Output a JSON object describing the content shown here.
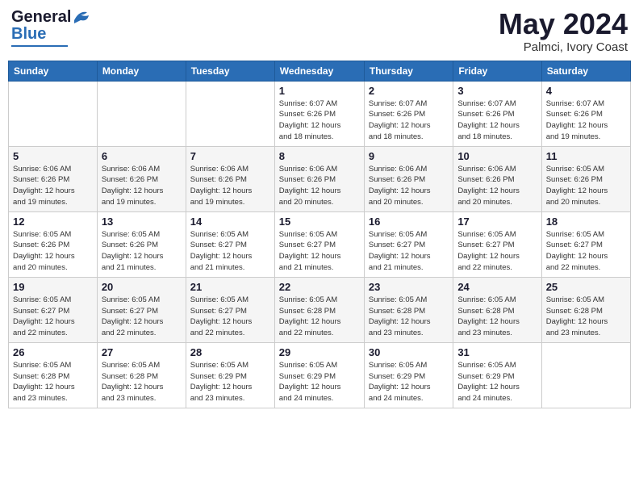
{
  "logo": {
    "general": "General",
    "blue": "Blue"
  },
  "title": "May 2024",
  "location": "Palmci, Ivory Coast",
  "days_header": [
    "Sunday",
    "Monday",
    "Tuesday",
    "Wednesday",
    "Thursday",
    "Friday",
    "Saturday"
  ],
  "weeks": [
    [
      {
        "day": "",
        "info": ""
      },
      {
        "day": "",
        "info": ""
      },
      {
        "day": "",
        "info": ""
      },
      {
        "day": "1",
        "info": "Sunrise: 6:07 AM\nSunset: 6:26 PM\nDaylight: 12 hours\nand 18 minutes."
      },
      {
        "day": "2",
        "info": "Sunrise: 6:07 AM\nSunset: 6:26 PM\nDaylight: 12 hours\nand 18 minutes."
      },
      {
        "day": "3",
        "info": "Sunrise: 6:07 AM\nSunset: 6:26 PM\nDaylight: 12 hours\nand 18 minutes."
      },
      {
        "day": "4",
        "info": "Sunrise: 6:07 AM\nSunset: 6:26 PM\nDaylight: 12 hours\nand 19 minutes."
      }
    ],
    [
      {
        "day": "5",
        "info": "Sunrise: 6:06 AM\nSunset: 6:26 PM\nDaylight: 12 hours\nand 19 minutes."
      },
      {
        "day": "6",
        "info": "Sunrise: 6:06 AM\nSunset: 6:26 PM\nDaylight: 12 hours\nand 19 minutes."
      },
      {
        "day": "7",
        "info": "Sunrise: 6:06 AM\nSunset: 6:26 PM\nDaylight: 12 hours\nand 19 minutes."
      },
      {
        "day": "8",
        "info": "Sunrise: 6:06 AM\nSunset: 6:26 PM\nDaylight: 12 hours\nand 20 minutes."
      },
      {
        "day": "9",
        "info": "Sunrise: 6:06 AM\nSunset: 6:26 PM\nDaylight: 12 hours\nand 20 minutes."
      },
      {
        "day": "10",
        "info": "Sunrise: 6:06 AM\nSunset: 6:26 PM\nDaylight: 12 hours\nand 20 minutes."
      },
      {
        "day": "11",
        "info": "Sunrise: 6:05 AM\nSunset: 6:26 PM\nDaylight: 12 hours\nand 20 minutes."
      }
    ],
    [
      {
        "day": "12",
        "info": "Sunrise: 6:05 AM\nSunset: 6:26 PM\nDaylight: 12 hours\nand 20 minutes."
      },
      {
        "day": "13",
        "info": "Sunrise: 6:05 AM\nSunset: 6:26 PM\nDaylight: 12 hours\nand 21 minutes."
      },
      {
        "day": "14",
        "info": "Sunrise: 6:05 AM\nSunset: 6:27 PM\nDaylight: 12 hours\nand 21 minutes."
      },
      {
        "day": "15",
        "info": "Sunrise: 6:05 AM\nSunset: 6:27 PM\nDaylight: 12 hours\nand 21 minutes."
      },
      {
        "day": "16",
        "info": "Sunrise: 6:05 AM\nSunset: 6:27 PM\nDaylight: 12 hours\nand 21 minutes."
      },
      {
        "day": "17",
        "info": "Sunrise: 6:05 AM\nSunset: 6:27 PM\nDaylight: 12 hours\nand 22 minutes."
      },
      {
        "day": "18",
        "info": "Sunrise: 6:05 AM\nSunset: 6:27 PM\nDaylight: 12 hours\nand 22 minutes."
      }
    ],
    [
      {
        "day": "19",
        "info": "Sunrise: 6:05 AM\nSunset: 6:27 PM\nDaylight: 12 hours\nand 22 minutes."
      },
      {
        "day": "20",
        "info": "Sunrise: 6:05 AM\nSunset: 6:27 PM\nDaylight: 12 hours\nand 22 minutes."
      },
      {
        "day": "21",
        "info": "Sunrise: 6:05 AM\nSunset: 6:27 PM\nDaylight: 12 hours\nand 22 minutes."
      },
      {
        "day": "22",
        "info": "Sunrise: 6:05 AM\nSunset: 6:28 PM\nDaylight: 12 hours\nand 22 minutes."
      },
      {
        "day": "23",
        "info": "Sunrise: 6:05 AM\nSunset: 6:28 PM\nDaylight: 12 hours\nand 23 minutes."
      },
      {
        "day": "24",
        "info": "Sunrise: 6:05 AM\nSunset: 6:28 PM\nDaylight: 12 hours\nand 23 minutes."
      },
      {
        "day": "25",
        "info": "Sunrise: 6:05 AM\nSunset: 6:28 PM\nDaylight: 12 hours\nand 23 minutes."
      }
    ],
    [
      {
        "day": "26",
        "info": "Sunrise: 6:05 AM\nSunset: 6:28 PM\nDaylight: 12 hours\nand 23 minutes."
      },
      {
        "day": "27",
        "info": "Sunrise: 6:05 AM\nSunset: 6:28 PM\nDaylight: 12 hours\nand 23 minutes."
      },
      {
        "day": "28",
        "info": "Sunrise: 6:05 AM\nSunset: 6:29 PM\nDaylight: 12 hours\nand 23 minutes."
      },
      {
        "day": "29",
        "info": "Sunrise: 6:05 AM\nSunset: 6:29 PM\nDaylight: 12 hours\nand 24 minutes."
      },
      {
        "day": "30",
        "info": "Sunrise: 6:05 AM\nSunset: 6:29 PM\nDaylight: 12 hours\nand 24 minutes."
      },
      {
        "day": "31",
        "info": "Sunrise: 6:05 AM\nSunset: 6:29 PM\nDaylight: 12 hours\nand 24 minutes."
      },
      {
        "day": "",
        "info": ""
      }
    ]
  ]
}
